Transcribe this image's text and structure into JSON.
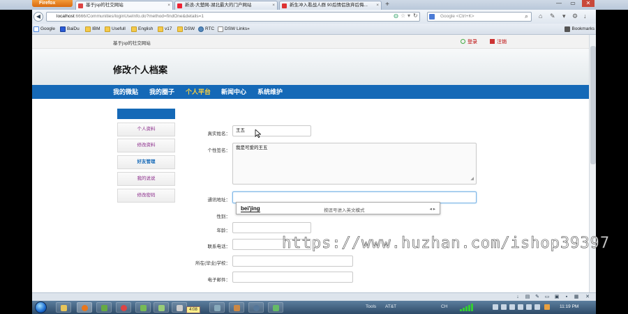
{
  "browser": {
    "app_button": "Firefox",
    "tabs": [
      {
        "label": "基于jsp的社交网站",
        "active": true
      },
      {
        "label": "新浪-大楚网-湖北最大的门户网站",
        "active": false
      },
      {
        "label": "新生冲入看战人群 90后情侣放弃后悔...",
        "active": false
      }
    ],
    "new_tab": "+",
    "window_controls": [
      "—",
      "▭",
      "✕"
    ],
    "url_host": "localhost",
    "url_rest": ":6666/Communities/loginUseInfo.do?method=findOne&details=1",
    "search_placeholder": "Google <Ctrl+K>",
    "bookmarks": [
      "Google",
      "BaiDu",
      "IBM",
      "Usefull",
      "English",
      "v17",
      "DSW",
      "RTC",
      "DSW Links»"
    ],
    "bookmarks_menu": "Bookmarks"
  },
  "site": {
    "tagline": "基于jsp的社交网站",
    "login": "登录",
    "register": "注销",
    "page_title": "修改个人档案",
    "nav": [
      {
        "label": "我的微贴",
        "active": false
      },
      {
        "label": "我的圈子",
        "active": false
      },
      {
        "label": "个人平台",
        "active": true
      },
      {
        "label": "新闻中心",
        "active": false
      },
      {
        "label": "系统维护",
        "active": false
      }
    ],
    "sidebar": [
      {
        "label": "个人资料",
        "current": false
      },
      {
        "label": "修改资料",
        "current": false
      },
      {
        "label": "好友管理",
        "current": true
      },
      {
        "label": "我的说说",
        "current": false
      },
      {
        "label": "修改密码",
        "current": false
      }
    ]
  },
  "form": {
    "real_name_label": "真实姓名：",
    "real_name_value": "王五",
    "signature_label": "个性签名：",
    "signature_value": "我是可爱的王五",
    "address_label": "通讯地址：",
    "address_value": "",
    "gender_label": "性别：",
    "age_label": "年龄：",
    "age_value": "",
    "phone_label": "联系电话：",
    "phone_value": "",
    "school_label": "所在(毕业)学校：",
    "school_value": "",
    "email_label": "电子邮件：",
    "email_value": ""
  },
  "ime": {
    "typed": "bei'jing",
    "hint": "按逗号进入英文模式",
    "arrows": "◂ ▸"
  },
  "watermark": "https://www.huzhan.com/ishop39397",
  "taskbar": {
    "badge": "4:08",
    "tools": "Tools",
    "carrier": "AT&T",
    "lang": "CH",
    "clock": "11:19 PM"
  },
  "colors": {
    "nav_blue": "#1569b7",
    "nav_active": "#ffd23c",
    "sidebar_text": "#8a2a8a",
    "link_red": "#bb0000"
  }
}
